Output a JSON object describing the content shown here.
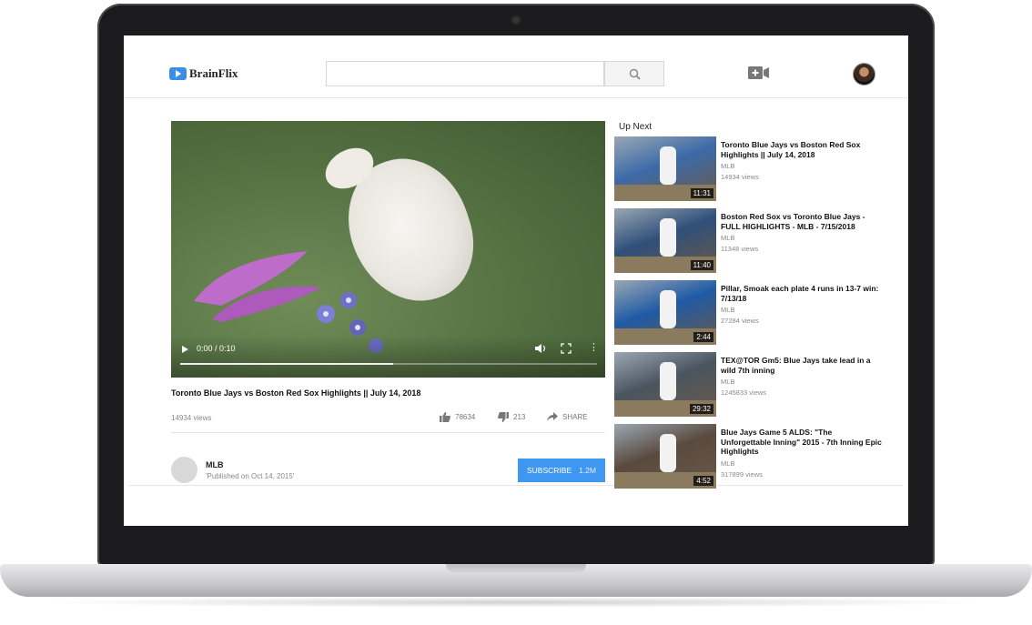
{
  "app": {
    "name": "BrainFlix"
  },
  "header": {
    "search_placeholder": "",
    "search_icon": "search-icon",
    "upload_icon": "video-camera-plus-icon"
  },
  "player": {
    "time": "0:00 / 0:10",
    "progress": 0.51
  },
  "video": {
    "title": "Toronto Blue Jays vs Boston Red Sox Highlights || July 14, 2018",
    "views": "14934 views",
    "likes": "78634",
    "dislikes": "213",
    "share_label": "SHARE"
  },
  "channel": {
    "name": "MLB",
    "published": "'Published on Oct 14, 2015'",
    "subscribe_label": "SUBSCRIBE",
    "subscribers": "1.2M"
  },
  "sidebar": {
    "heading": "Up Next",
    "items": [
      {
        "title": "Toronto Blue Jays vs Boston Red Sox Highlights || July 14, 2018",
        "channel": "MLB",
        "views": "14934 views",
        "duration": "11:31",
        "color": "#3c6aa8"
      },
      {
        "title": "Boston Red Sox vs Toronto Blue Jays - FULL HIGHLIGHTS - MLB - 7/15/2018",
        "channel": "MLB",
        "views": "11348 views",
        "duration": "11:40",
        "color": "#2f4f7a"
      },
      {
        "title": "Pillar, Smoak each plate 4 runs in 13-7 win: 7/13/18",
        "channel": "MLB",
        "views": "27284 views",
        "duration": "2:44",
        "color": "#1f5aa6"
      },
      {
        "title": "TEX@TOR Gm5: Blue Jays take lead in a wild 7th inning",
        "channel": "MLB",
        "views": "1245833 views",
        "duration": "29:32",
        "color": "#4a5560"
      },
      {
        "title": "Blue Jays Game 5 ALDS: \"The Unforgettable Inning\" 2015 - 7th Inning Epic Highlights",
        "channel": "MLB",
        "views": "317899 views",
        "duration": "4:52",
        "color": "#5a4a3e"
      }
    ]
  }
}
